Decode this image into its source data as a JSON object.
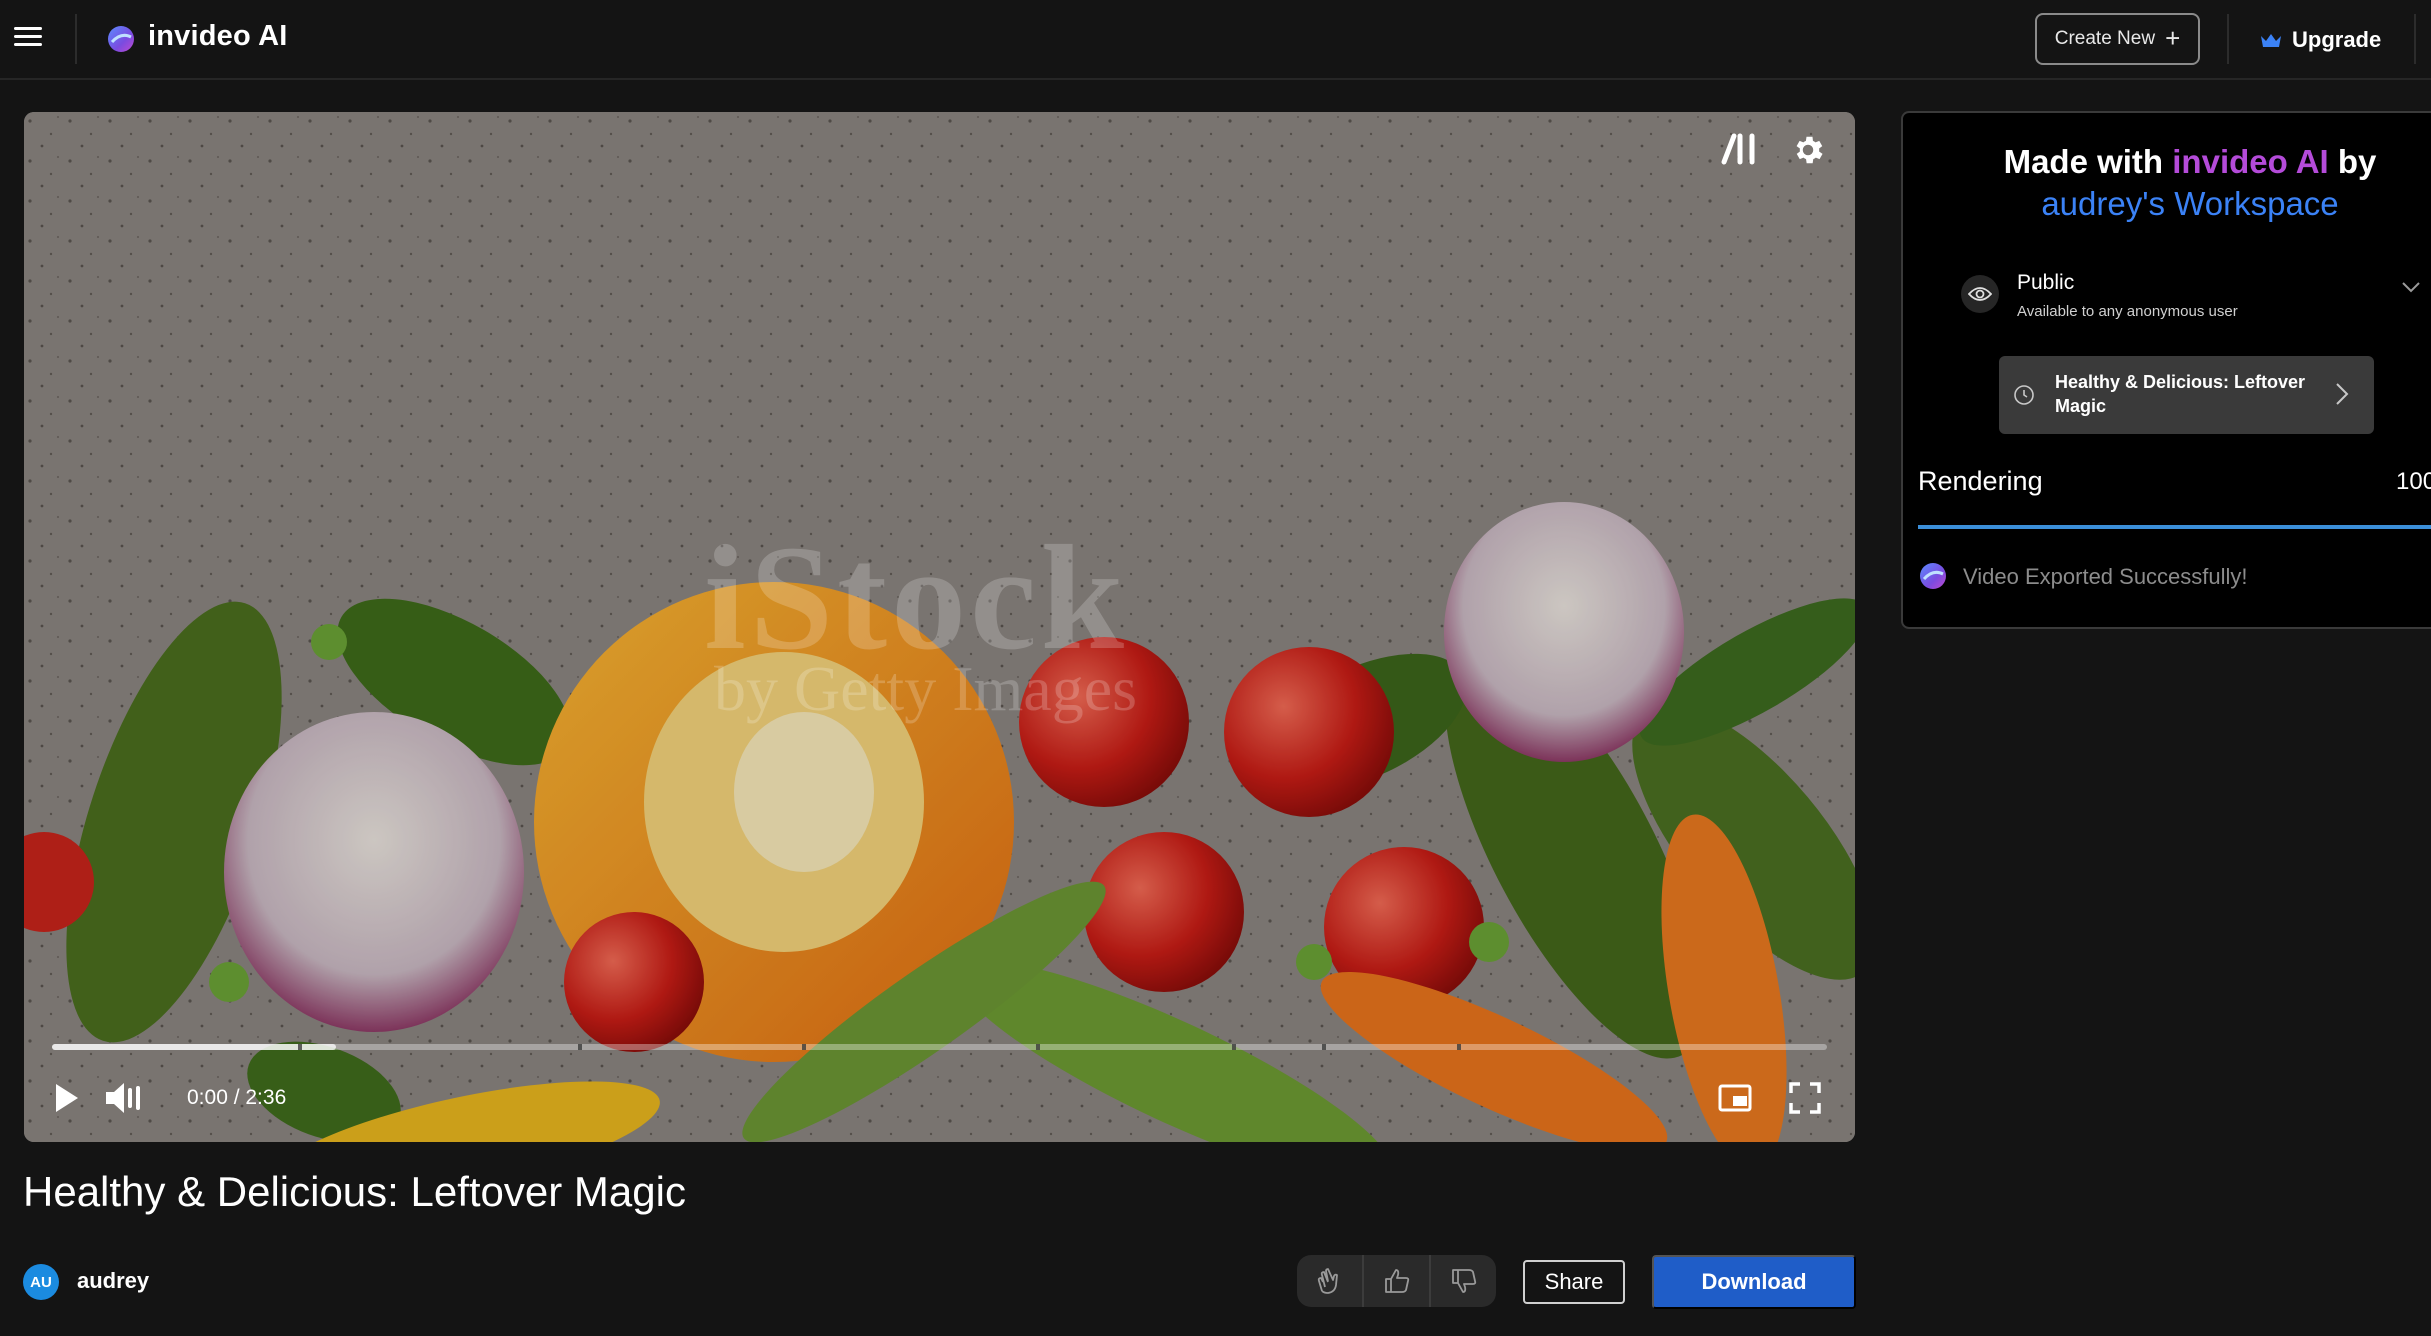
{
  "header": {
    "app_name": "invideo AI",
    "create_label": "Create New",
    "upgrade_label": "Upgrade"
  },
  "player": {
    "time_display": "0:00 / 2:36",
    "watermark_main": "iStock",
    "watermark_sub": "by Getty Images",
    "buffered_fraction": 0.16
  },
  "video": {
    "title": "Healthy & Delicious: Leftover Magic",
    "author_initials": "AU",
    "author_name": "audrey",
    "share_label": "Share",
    "download_label": "Download"
  },
  "side_panel": {
    "made_with_prefix": "Made with ",
    "made_with_brand": "invideo AI",
    "made_with_by": " by",
    "workspace": "audrey's Workspace",
    "visibility_title": "Public",
    "visibility_subtitle": "Available to any anonymous user",
    "project_name": "Healthy & Delicious: Leftover Magic",
    "rendering_label": "Rendering",
    "rendering_percent": "100",
    "rendering_fraction": 1.0,
    "export_message": "Video Exported Successfully!"
  },
  "colors": {
    "background": "#141414",
    "brand_purple": "#b44bd9",
    "workspace_blue": "#3b82f6",
    "download_blue": "#1f5dc8",
    "render_bar": "#3b8fd9"
  },
  "icons": {
    "menu": "hamburger-icon",
    "logo": "invideo-logo-icon",
    "upgrade": "crown-icon",
    "player_brand": "brand-mark-icon",
    "settings": "gear-icon",
    "play": "play-icon",
    "volume": "volume-icon",
    "pip": "picture-in-picture-icon",
    "fullscreen": "fullscreen-icon",
    "visibility": "eye-icon",
    "project": "clock-icon",
    "reactions": [
      "clap-icon",
      "thumbs-up-icon",
      "thumbs-down-icon"
    ]
  }
}
